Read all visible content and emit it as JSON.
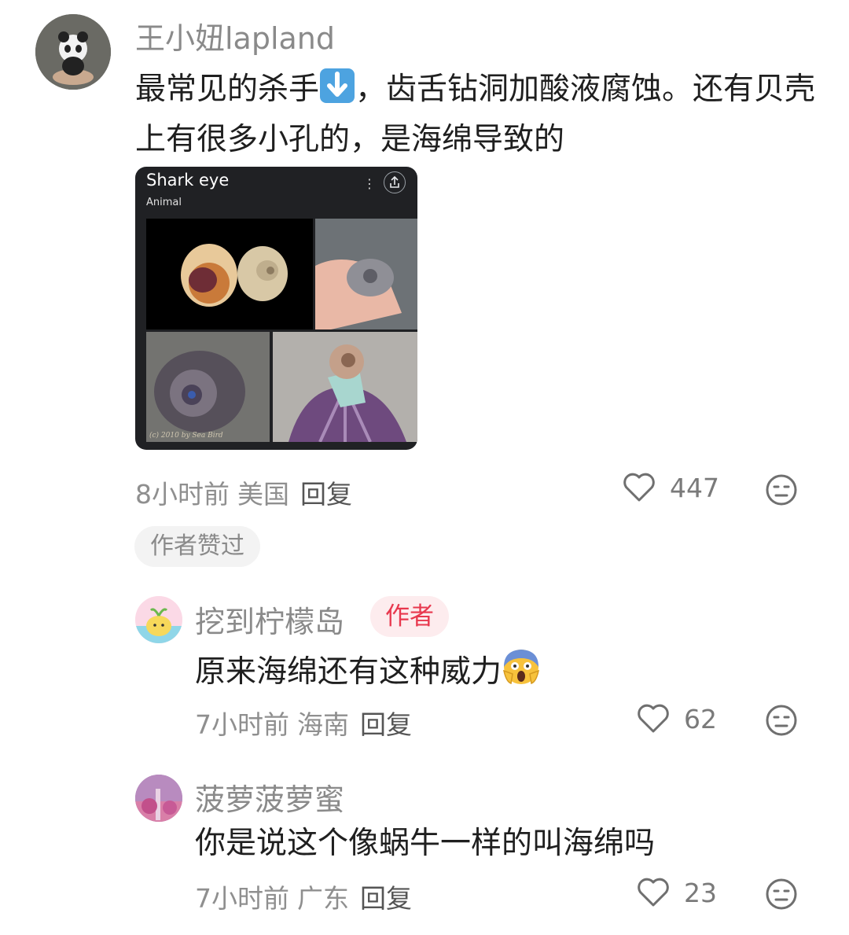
{
  "comments": [
    {
      "username": "王小妞lapland",
      "text_before_emoji": "最常见的杀手",
      "text_after_emoji": "，齿舌钻洞加酸液腐蚀。还有贝壳上有很多小孔的，是海绵导致的",
      "emoji": "down-arrow-emoji",
      "image_card": {
        "title": "Shark eye",
        "subtitle": "Animal",
        "more_icon": "⋮",
        "watermark": "(c) 2010 by Sea Bird"
      },
      "time": "8小时前",
      "location": "美国",
      "reply_label": "回复",
      "likes": "447",
      "author_liked_label": "作者赞过"
    },
    {
      "username": "挖到柠檬岛",
      "author_tag": "作者",
      "text": "原来海绵还有这种威力",
      "emoji": "screaming-face-emoji",
      "time": "7小时前",
      "location": "海南",
      "reply_label": "回复",
      "likes": "62"
    },
    {
      "username": "菠萝菠萝蜜",
      "text": "你是说这个像蜗牛一样的叫海绵吗",
      "time": "7小时前",
      "location": "广东",
      "reply_label": "回复",
      "likes": "23"
    }
  ],
  "colors": {
    "username": "#8a8a8a",
    "text": "#1f1f1f",
    "author_tag_bg": "#fdecee",
    "author_tag_text": "#e8384e",
    "card_bg": "#202124"
  }
}
